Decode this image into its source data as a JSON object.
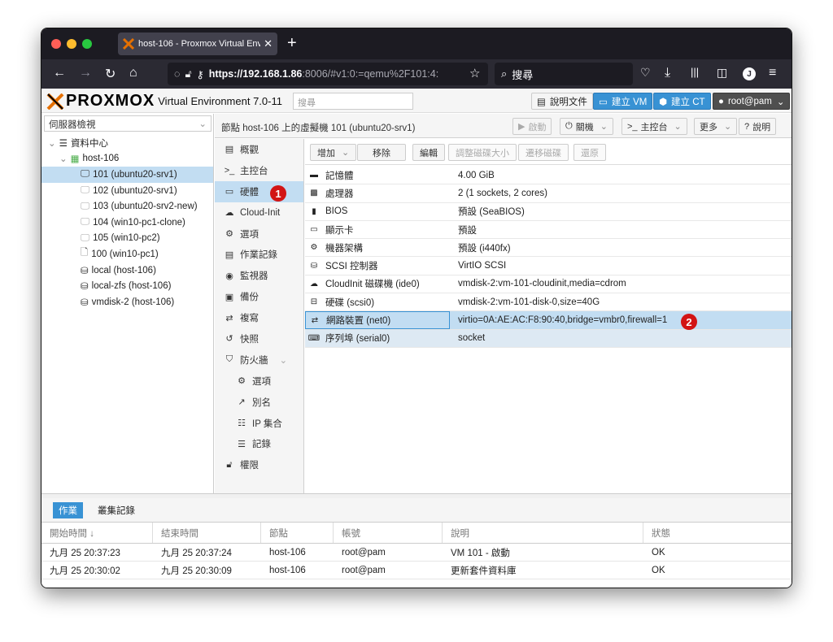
{
  "browser": {
    "tab_title": "host-106 - Proxmox Virtual Envi",
    "url_host": "https://192.168.1.86",
    "url_rest": ":8006/#v1:0:=qemu%2F101:4:",
    "search_placeholder": "搜尋"
  },
  "header": {
    "logo_text": "PROXMOX",
    "version_text": "Virtual Environment 7.0-11",
    "search_placeholder": "搜尋",
    "docs_label": "說明文件",
    "create_vm_label": "建立 VM",
    "create_ct_label": "建立 CT",
    "user_label": "root@pam"
  },
  "tree": {
    "view_selector": "伺服器檢視",
    "items": [
      {
        "label": "資料中心"
      },
      {
        "label": "host-106"
      },
      {
        "label": "101 (ubuntu20-srv1)"
      },
      {
        "label": "102 (ubuntu20-srv1)"
      },
      {
        "label": "103 (ubuntu20-srv2-new)"
      },
      {
        "label": "104 (win10-pc1-clone)"
      },
      {
        "label": "105 (win10-pc2)"
      },
      {
        "label": "100 (win10-pc1)"
      },
      {
        "label": "local (host-106)"
      },
      {
        "label": "local-zfs (host-106)"
      },
      {
        "label": "vmdisk-2 (host-106)"
      }
    ]
  },
  "vmhead": {
    "title": "節點 host-106 上的虛擬機 101 (ubuntu20-srv1)",
    "start": "啟動",
    "shutdown": "關機",
    "console": "主控台",
    "more": "更多",
    "help": "說明"
  },
  "nav": {
    "items": [
      {
        "label": "概觀"
      },
      {
        "label": "主控台"
      },
      {
        "label": "硬體"
      },
      {
        "label": "Cloud-Init"
      },
      {
        "label": "選項"
      },
      {
        "label": "作業記錄"
      },
      {
        "label": "監視器"
      },
      {
        "label": "備份"
      },
      {
        "label": "複寫"
      },
      {
        "label": "快照"
      },
      {
        "label": "防火牆"
      },
      {
        "label": "選項"
      },
      {
        "label": "別名"
      },
      {
        "label": "IP 集合"
      },
      {
        "label": "記錄"
      },
      {
        "label": "權限"
      }
    ]
  },
  "toolbar": {
    "add": "增加",
    "remove": "移除",
    "edit": "編輯",
    "resize": "調整磁碟大小",
    "move": "遷移磁碟",
    "revert": "還原"
  },
  "hardware": {
    "rows": [
      {
        "key": "記憶體",
        "value": "4.00 GiB"
      },
      {
        "key": "處理器",
        "value": "2 (1 sockets, 2 cores)"
      },
      {
        "key": "BIOS",
        "value": "預設 (SeaBIOS)"
      },
      {
        "key": "顯示卡",
        "value": "預設"
      },
      {
        "key": "機器架構",
        "value": "預設 (i440fx)"
      },
      {
        "key": "SCSI 控制器",
        "value": "VirtIO SCSI"
      },
      {
        "key": "CloudInit 磁碟機 (ide0)",
        "value": "vmdisk-2:vm-101-cloudinit,media=cdrom"
      },
      {
        "key": "硬碟 (scsi0)",
        "value": "vmdisk-2:vm-101-disk-0,size=40G"
      },
      {
        "key": "網路裝置 (net0)",
        "value": "virtio=0A:AE:AC:F8:90:40,bridge=vmbr0,firewall=1"
      },
      {
        "key": "序列埠 (serial0)",
        "value": "socket"
      }
    ]
  },
  "badges": {
    "one": "1",
    "two": "2"
  },
  "tasks": {
    "tab_tasks": "作業",
    "tab_cluster_log": "叢集記錄",
    "columns": [
      "開始時間 ↓",
      "結束時間",
      "節點",
      "帳號",
      "說明",
      "狀態"
    ],
    "rows": [
      [
        "九月 25 20:37:23",
        "九月 25 20:37:24",
        "host-106",
        "root@pam",
        "VM 101 - 啟動",
        "OK"
      ],
      [
        "九月 25 20:30:02",
        "九月 25 20:30:09",
        "host-106",
        "root@pam",
        "更新套件資料庫",
        "OK"
      ]
    ]
  }
}
